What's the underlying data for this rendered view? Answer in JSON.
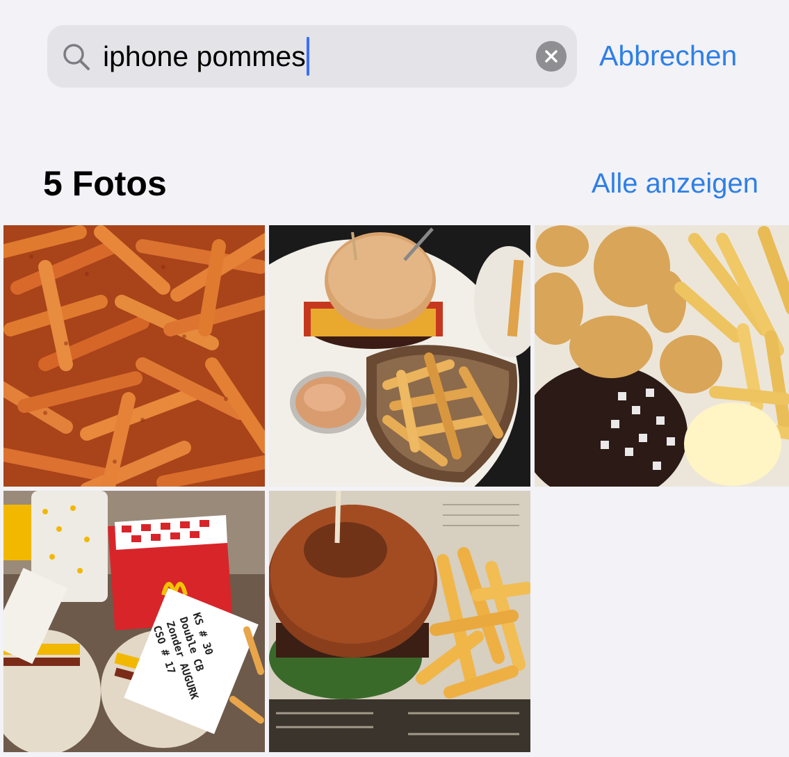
{
  "search": {
    "query": "iphone pommes",
    "icon": "search-icon",
    "clear_icon": "clear-circle-icon",
    "cancel_label": "Abbrechen",
    "accent_color": "#2f7fe6",
    "caret_color": "#3b6ff5"
  },
  "results": {
    "title": "5 Fotos",
    "see_all_label": "Alle anzeigen",
    "photos": [
      {
        "subject": "seasoned fries"
      },
      {
        "subject": "bacon cheeseburger with fries and dip"
      },
      {
        "subject": "nuggets with fries, onions and sauce"
      },
      {
        "subject": "McDonald's takeaway meal with receipts"
      },
      {
        "subject": "burger with fries in newspaper basket"
      }
    ]
  },
  "receipt_text": [
    "KS # 30",
    "Double CB",
    "Zonder AUGURK",
    "CSO # 17"
  ]
}
